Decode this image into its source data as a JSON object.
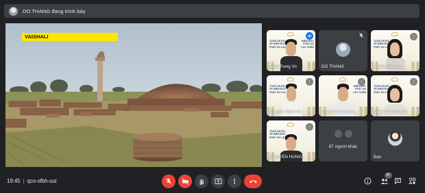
{
  "app": {
    "presenter_label": "DO THANG đang trình bày"
  },
  "presentation": {
    "slide_title": "VAISHALI"
  },
  "participants": [
    {
      "name": "Đinh Trung Vo",
      "speaking": true,
      "video": "camera"
    },
    {
      "name": "DO THANG",
      "speaking": false,
      "video": "avatar"
    },
    {
      "name": "33.Vu Nguyen...",
      "speaking": false,
      "video": "camera"
    },
    {
      "name": "Nguyễn Minh Tri...",
      "speaking": false,
      "video": "camera"
    },
    {
      "name": "Trần Hữu Lương...",
      "speaking": false,
      "video": "camera"
    },
    {
      "name": "Giáo Thanh Ngân",
      "speaking": false,
      "video": "camera"
    },
    {
      "name": "NGUYỄN HÙNG...",
      "speaking": false,
      "video": "camera"
    },
    {
      "name": "87 người khác",
      "speaking": false,
      "video": "others"
    },
    {
      "name": "Bạn",
      "speaking": false,
      "video": "avatar"
    }
  ],
  "banner_text": {
    "left": "TOUR ẢN ĐỘ - VỀ MIỀN ĐỨC PHẬT AN LẠC",
    "right": "MIỀN ĐỨC PHẬT AN LẠC CHÂN"
  },
  "bottombar": {
    "time": "19:45",
    "separator": "|",
    "meeting_code": "qco-sfbh-uui",
    "people_count": "97"
  },
  "colors": {
    "background": "#202124",
    "tile": "#3c4043",
    "danger": "#ea4335",
    "active_outline": "#8ab4f8",
    "slide_accent": "#ffe500"
  },
  "icons": {
    "mic": "mic-off-icon",
    "camera": "videocam-off-icon",
    "raise_hand": "hand-icon",
    "present": "present-to-all-icon",
    "more": "more-vert-icon",
    "hangup": "call-end-icon",
    "info": "info-icon",
    "people": "people-icon",
    "chat": "chat-icon",
    "activities": "activities-icon"
  }
}
